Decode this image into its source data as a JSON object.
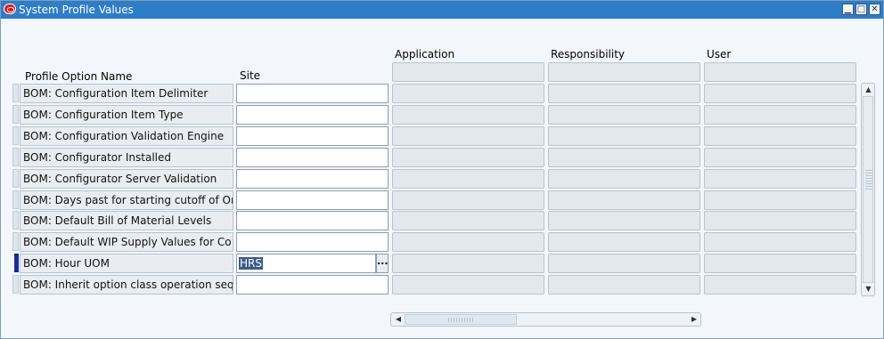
{
  "window": {
    "title": "System Profile Values",
    "controls": {
      "minimize": "▁",
      "maximize": "□",
      "close": "✕"
    }
  },
  "columns": {
    "profile_option_name": "Profile Option Name",
    "site": "Site",
    "application": "Application",
    "responsibility": "Responsibility",
    "user": "User"
  },
  "rows": [
    {
      "name": "BOM: Configuration Item Delimiter",
      "site": ""
    },
    {
      "name": "BOM: Configuration Item Type",
      "site": ""
    },
    {
      "name": "BOM: Configuration Validation Engine",
      "site": ""
    },
    {
      "name": "BOM: Configurator Installed",
      "site": ""
    },
    {
      "name": "BOM: Configurator Server Validation",
      "site": ""
    },
    {
      "name": "BOM: Days past for starting cutoff of Orc",
      "site": ""
    },
    {
      "name": "BOM: Default Bill of Material Levels",
      "site": ""
    },
    {
      "name": "BOM: Default WIP Supply Values for Co",
      "site": ""
    },
    {
      "name": "BOM: Hour UOM",
      "site": "HRS",
      "active": true
    },
    {
      "name": "BOM: Inherit option class operation sequ",
      "site": ""
    }
  ],
  "lov_button": "..."
}
